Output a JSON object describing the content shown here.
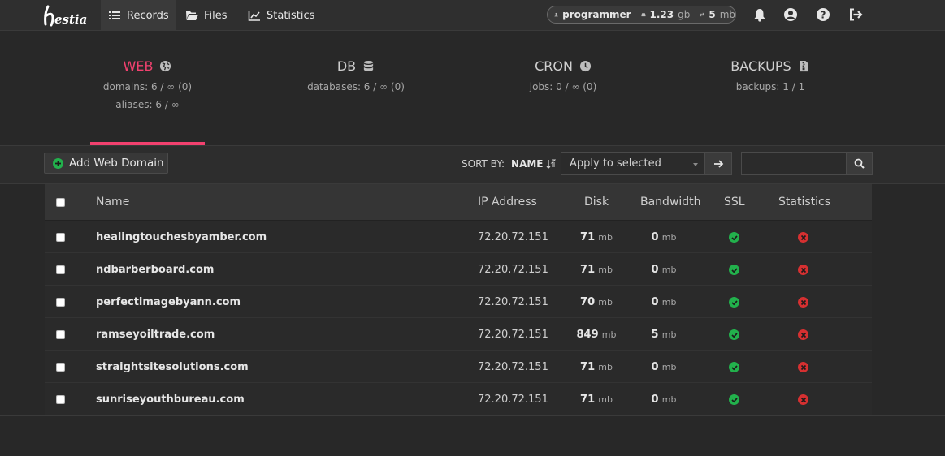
{
  "nav": {
    "records": "Records",
    "files": "Files",
    "statistics": "Statistics"
  },
  "user": {
    "name": "programmer",
    "disk_value": "1.23",
    "disk_unit": "gb",
    "bw_value": "5",
    "bw_unit": "mb"
  },
  "tabs": [
    {
      "title": "WEB",
      "stats": [
        "domains: 6 / ∞ (0)",
        "aliases: 6 / ∞"
      ]
    },
    {
      "title": "DB",
      "stats": [
        "databases: 6 / ∞ (0)"
      ]
    },
    {
      "title": "CRON",
      "stats": [
        "jobs: 0 / ∞ (0)"
      ]
    },
    {
      "title": "BACKUPS",
      "stats": [
        "backups: 1 / 1"
      ]
    }
  ],
  "toolbar": {
    "add_label": "Add Web Domain",
    "sort_by": "SORT BY:",
    "sort_field": "NAME",
    "apply_selected": "Apply to selected",
    "search_value": ""
  },
  "table": {
    "headers": {
      "name": "Name",
      "ip": "IP Address",
      "disk": "Disk",
      "bandwidth": "Bandwidth",
      "ssl": "SSL",
      "statistics": "Statistics"
    },
    "unit": "mb",
    "rows": [
      {
        "name": "healingtouchesbyamber.com",
        "ip": "72.20.72.151",
        "disk": "71",
        "bandwidth": "0"
      },
      {
        "name": "ndbarberboard.com",
        "ip": "72.20.72.151",
        "disk": "71",
        "bandwidth": "0"
      },
      {
        "name": "perfectimagebyann.com",
        "ip": "72.20.72.151",
        "disk": "70",
        "bandwidth": "0"
      },
      {
        "name": "ramseyoiltrade.com",
        "ip": "72.20.72.151",
        "disk": "849",
        "bandwidth": "5"
      },
      {
        "name": "straightsitesolutions.com",
        "ip": "72.20.72.151",
        "disk": "71",
        "bandwidth": "0"
      },
      {
        "name": "sunriseyouthbureau.com",
        "ip": "72.20.72.151",
        "disk": "71",
        "bandwidth": "0"
      }
    ]
  },
  "colors": {
    "accent": "#f2416f",
    "ok": "#22b14c",
    "error": "#d63031"
  }
}
